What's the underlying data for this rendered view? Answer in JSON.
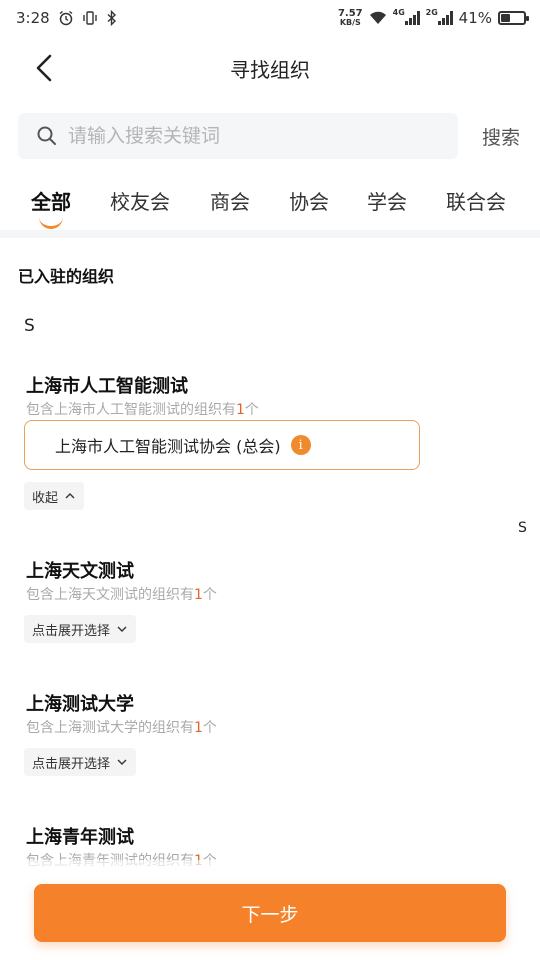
{
  "status_bar": {
    "time": "3:28",
    "net_speed": "7.57",
    "net_unit": "KB/S",
    "signal1_label": "4G",
    "signal2_label": "2G",
    "battery": "41%",
    "battery_level": 0.41,
    "icons": [
      "alarm-icon",
      "vibrate-icon",
      "bluetooth-icon"
    ]
  },
  "nav": {
    "title": "寻找组织"
  },
  "search": {
    "placeholder": "请输入搜索关键词",
    "value": "",
    "button_label": "搜索"
  },
  "tabs": [
    {
      "label": "全部",
      "active": true
    },
    {
      "label": "校友会",
      "active": false
    },
    {
      "label": "商会",
      "active": false
    },
    {
      "label": "协会",
      "active": false
    },
    {
      "label": "学会",
      "active": false
    },
    {
      "label": "联合会",
      "active": false
    }
  ],
  "section": {
    "title": "已入驻的组织",
    "index_letter": "S",
    "side_letter": "S"
  },
  "orgs": [
    {
      "name": "上海市人工智能测试",
      "desc_prefix": "包含上海市人工智能测试的组织有",
      "count": "1",
      "desc_suffix": "个",
      "expanded": true,
      "sub_items": [
        "上海市人工智能测试协会 (总会)"
      ],
      "toggle_label": "收起"
    },
    {
      "name": "上海天文测试",
      "desc_prefix": "包含上海天文测试的组织有",
      "count": "1",
      "desc_suffix": "个",
      "expanded": false,
      "toggle_label": "点击展开选择"
    },
    {
      "name": "上海测试大学",
      "desc_prefix": "包含上海测试大学的组织有",
      "count": "1",
      "desc_suffix": "个",
      "expanded": false,
      "toggle_label": "点击展开选择"
    },
    {
      "name": "上海青年测试",
      "desc_prefix": "包含上海青年测试的组织有",
      "count": "1",
      "desc_suffix": "个",
      "expanded": false
    }
  ],
  "footer": {
    "next_label": "下一步"
  },
  "colors": {
    "accent": "#f5822a",
    "count_red": "#e2662b",
    "border_orange": "#e8a05b"
  }
}
